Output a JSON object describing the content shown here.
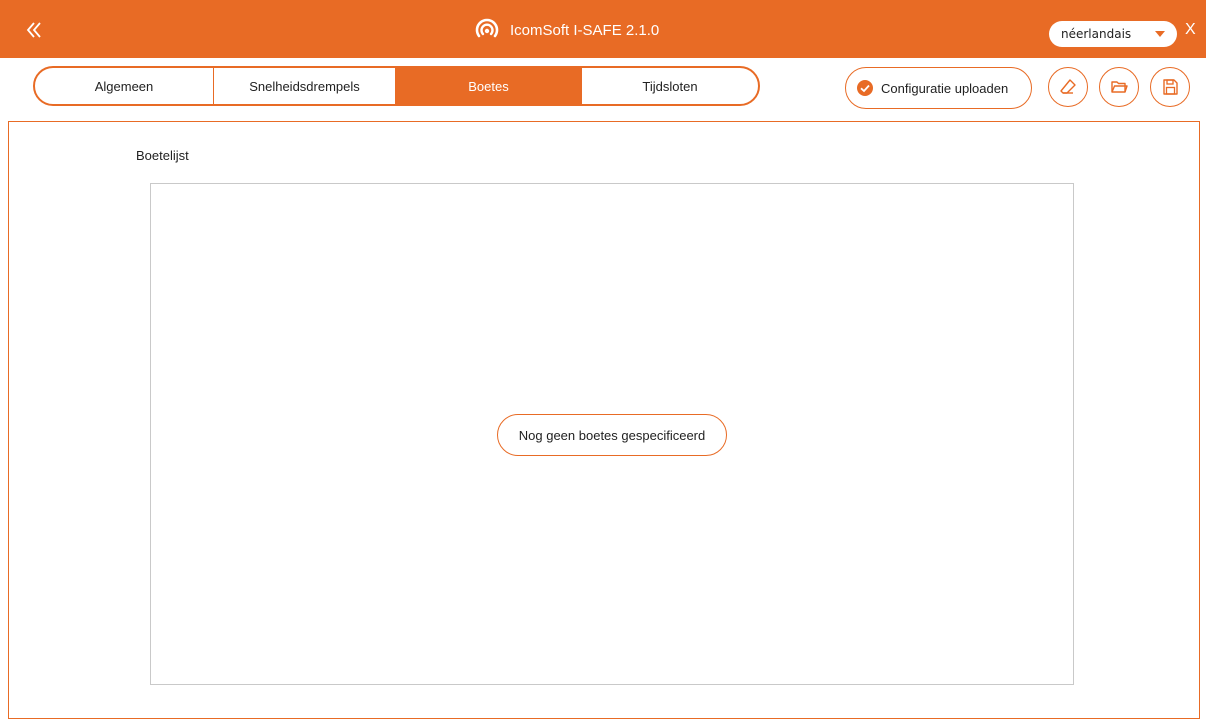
{
  "titlebar": {
    "app_title": "IcomSoft I-SAFE 2.1.0",
    "language_selected": "néerlandais",
    "close_label": "X"
  },
  "tabs": [
    {
      "label": "Algemeen",
      "active": false
    },
    {
      "label": "Snelheidsdrempels",
      "active": false
    },
    {
      "label": "Boetes",
      "active": true
    },
    {
      "label": "Tijdsloten",
      "active": false
    }
  ],
  "toolbar": {
    "upload_label": "Configuratie uploaden"
  },
  "content": {
    "list_label": "Boetelijst",
    "empty_message": "Nog geen boetes gespecificeerd"
  },
  "colors": {
    "accent": "#e86b25",
    "border_gray": "#c9c9c9"
  },
  "icons": [
    "double-chevron-left-icon",
    "wifi-signal-logo-icon",
    "caret-down-icon",
    "check-circle-icon",
    "eraser-icon",
    "folder-open-icon",
    "save-icon"
  ]
}
